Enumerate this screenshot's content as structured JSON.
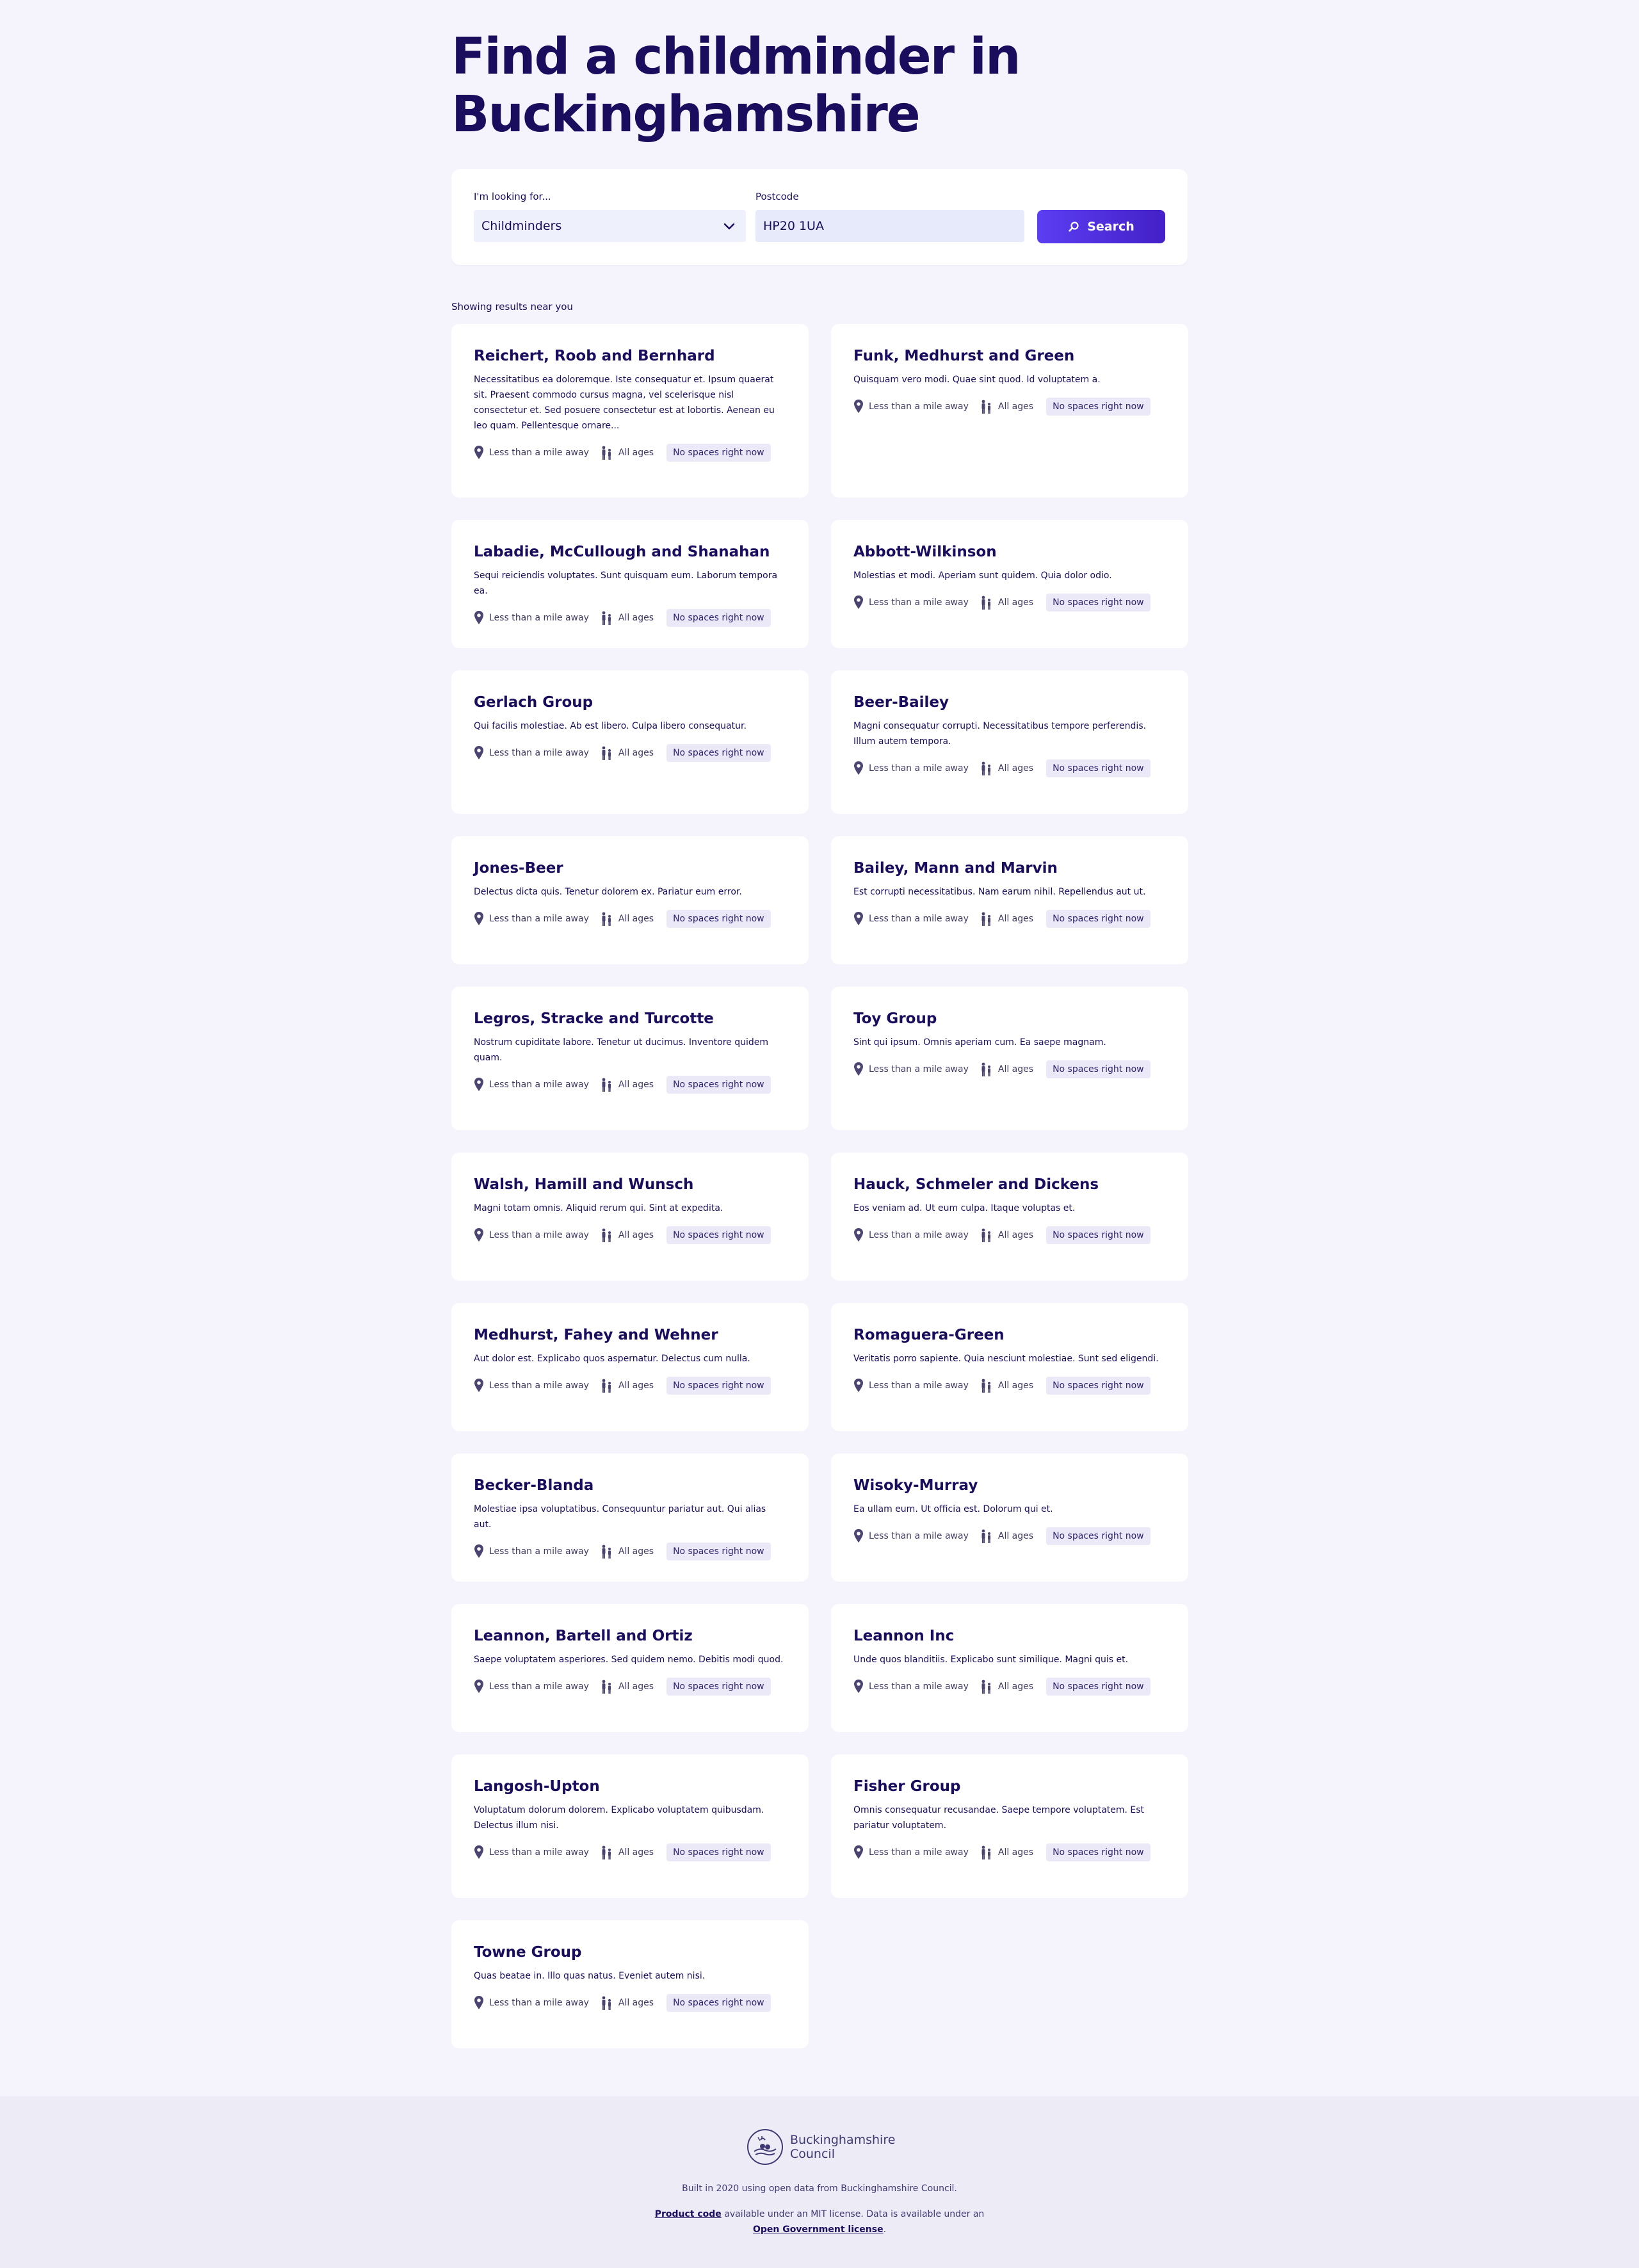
{
  "header": {
    "title": "Find a childminder in Buckinghamshire"
  },
  "search": {
    "looking_for_label": "I'm looking for...",
    "looking_for_value": "Childminders",
    "postcode_label": "Postcode",
    "postcode_value": "HP20 1UA",
    "button_label": "Search"
  },
  "results_note": "Showing results near you",
  "results": [
    {
      "name": "Reichert, Roob and Bernhard",
      "description": "Necessitatibus ea doloremque. Iste consequatur et. Ipsum quaerat sit. Praesent commodo cursus magna, vel scelerisque nisl consectetur et. Sed posuere consectetur est at lobortis. Aenean eu leo quam. Pellentesque ornare...",
      "distance": "Less than a mile away",
      "ages": "All ages",
      "availability": "No spaces right now"
    },
    {
      "name": "Funk, Medhurst and Green",
      "description": "Quisquam vero modi. Quae sint quod. Id voluptatem a.",
      "distance": "Less than a mile away",
      "ages": "All ages",
      "availability": "No spaces right now"
    },
    {
      "name": "Labadie, McCullough and Shanahan",
      "description": "Sequi reiciendis voluptates. Sunt quisquam eum. Laborum tempora ea.",
      "distance": "Less than a mile away",
      "ages": "All ages",
      "availability": "No spaces right now"
    },
    {
      "name": "Abbott-Wilkinson",
      "description": "Molestias et modi. Aperiam sunt quidem. Quia dolor odio.",
      "distance": "Less than a mile away",
      "ages": "All ages",
      "availability": "No spaces right now"
    },
    {
      "name": "Gerlach Group",
      "description": "Qui facilis molestiae. Ab est libero. Culpa libero consequatur.",
      "distance": "Less than a mile away",
      "ages": "All ages",
      "availability": "No spaces right now"
    },
    {
      "name": "Beer-Bailey",
      "description": "Magni consequatur corrupti. Necessitatibus tempore perferendis. Illum autem tempora.",
      "distance": "Less than a mile away",
      "ages": "All ages",
      "availability": "No spaces right now"
    },
    {
      "name": "Jones-Beer",
      "description": "Delectus dicta quis. Tenetur dolorem ex. Pariatur eum error.",
      "distance": "Less than a mile away",
      "ages": "All ages",
      "availability": "No spaces right now"
    },
    {
      "name": "Bailey, Mann and Marvin",
      "description": "Est corrupti necessitatibus. Nam earum nihil. Repellendus aut ut.",
      "distance": "Less than a mile away",
      "ages": "All ages",
      "availability": "No spaces right now"
    },
    {
      "name": "Legros, Stracke and Turcotte",
      "description": "Nostrum cupiditate labore. Tenetur ut ducimus. Inventore quidem quam.",
      "distance": "Less than a mile away",
      "ages": "All ages",
      "availability": "No spaces right now"
    },
    {
      "name": "Toy Group",
      "description": "Sint qui ipsum. Omnis aperiam cum. Ea saepe magnam.",
      "distance": "Less than a mile away",
      "ages": "All ages",
      "availability": "No spaces right now"
    },
    {
      "name": "Walsh, Hamill and Wunsch",
      "description": "Magni totam omnis. Aliquid rerum qui. Sint at expedita.",
      "distance": "Less than a mile away",
      "ages": "All ages",
      "availability": "No spaces right now"
    },
    {
      "name": "Hauck, Schmeler and Dickens",
      "description": "Eos veniam ad. Ut eum culpa. Itaque voluptas et.",
      "distance": "Less than a mile away",
      "ages": "All ages",
      "availability": "No spaces right now"
    },
    {
      "name": "Medhurst, Fahey and Wehner",
      "description": "Aut dolor est. Explicabo quos aspernatur. Delectus cum nulla.",
      "distance": "Less than a mile away",
      "ages": "All ages",
      "availability": "No spaces right now"
    },
    {
      "name": "Romaguera-Green",
      "description": "Veritatis porro sapiente. Quia nesciunt molestiae. Sunt sed eligendi.",
      "distance": "Less than a mile away",
      "ages": "All ages",
      "availability": "No spaces right now"
    },
    {
      "name": "Becker-Blanda",
      "description": "Molestiae ipsa voluptatibus. Consequuntur pariatur aut. Qui alias aut.",
      "distance": "Less than a mile away",
      "ages": "All ages",
      "availability": "No spaces right now"
    },
    {
      "name": "Wisoky-Murray",
      "description": "Ea ullam eum. Ut officia est. Dolorum qui et.",
      "distance": "Less than a mile away",
      "ages": "All ages",
      "availability": "No spaces right now"
    },
    {
      "name": "Leannon, Bartell and Ortiz",
      "description": "Saepe voluptatem asperiores. Sed quidem nemo. Debitis modi quod.",
      "distance": "Less than a mile away",
      "ages": "All ages",
      "availability": "No spaces right now"
    },
    {
      "name": "Leannon Inc",
      "description": "Unde quos blanditiis. Explicabo sunt similique. Magni quis et.",
      "distance": "Less than a mile away",
      "ages": "All ages",
      "availability": "No spaces right now"
    },
    {
      "name": "Langosh-Upton",
      "description": "Voluptatum dolorum dolorem. Explicabo voluptatem quibusdam. Delectus illum nisi.",
      "distance": "Less than a mile away",
      "ages": "All ages",
      "availability": "No spaces right now"
    },
    {
      "name": "Fisher Group",
      "description": "Omnis consequatur recusandae. Saepe tempore voluptatem. Est pariatur voluptatem.",
      "distance": "Less than a mile away",
      "ages": "All ages",
      "availability": "No spaces right now"
    },
    {
      "name": "Towne Group",
      "description": "Quas beatae in. Illo quas natus. Eveniet autem nisi.",
      "distance": "Less than a mile away",
      "ages": "All ages",
      "availability": "No spaces right now"
    }
  ],
  "icons": {
    "distance": "map-pin-icon",
    "ages": "people-icon",
    "search": "search-icon",
    "dropdown": "chevron-down-icon"
  },
  "footer": {
    "logo_text": "Buckinghamshire Council",
    "built_text": "Built in 2020 using open data from Buckinghamshire Council.",
    "product_code_link": "Product code",
    "license_text_1": " available under an MIT license. Data is available under an ",
    "open_gov_link": "Open Government license",
    "license_text_2": "."
  },
  "colors": {
    "page_bg": "#f5f4fc",
    "brand_text": "#1b0d5e",
    "accent": "#5c3ef2",
    "badge_bg": "#ebe9f7",
    "footer_bg": "#ecebf6"
  }
}
